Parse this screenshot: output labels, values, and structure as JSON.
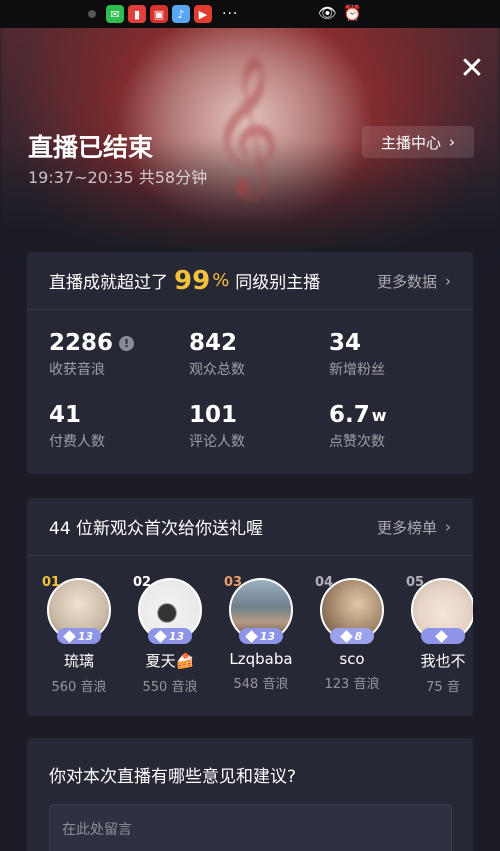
{
  "status_bar": {
    "apps": [
      {
        "icon": "wechat-icon",
        "color": "#2fbd52",
        "glyph": "✉"
      },
      {
        "icon": "book-icon",
        "color": "#e0403c",
        "glyph": "▮"
      },
      {
        "icon": "news-icon",
        "color": "#d8322e",
        "glyph": "▣"
      },
      {
        "icon": "music-icon",
        "color": "#5aa6f2",
        "glyph": "♪"
      },
      {
        "icon": "video-icon",
        "color": "#e23b2f",
        "glyph": "▶"
      }
    ],
    "more": "···",
    "right_icons": [
      "eye-icon",
      "alarm-icon"
    ]
  },
  "header": {
    "title": "直播已结束",
    "time_range": "19:37~20:35 共58分钟",
    "host_center_label": "主播中心"
  },
  "achievement": {
    "prefix": "直播成就超过了",
    "percent": "99",
    "percent_sign": "%",
    "suffix": "同级别主播",
    "more_label": "更多数据",
    "accent_color": "#f5c23e"
  },
  "stats": [
    {
      "value": "2286",
      "unit": "",
      "label": "收获音浪",
      "info": true
    },
    {
      "value": "842",
      "unit": "",
      "label": "观众总数",
      "info": false
    },
    {
      "value": "34",
      "unit": "",
      "label": "新增粉丝",
      "info": false
    },
    {
      "value": "41",
      "unit": "",
      "label": "付费人数",
      "info": false
    },
    {
      "value": "101",
      "unit": "",
      "label": "评论人数",
      "info": false
    },
    {
      "value": "6.7",
      "unit": "w",
      "label": "点赞次数",
      "info": false
    }
  ],
  "gifts": {
    "title": "44 位新观众首次给你送礼喔",
    "more_label": "更多榜单",
    "gifters": [
      {
        "rank": "01",
        "rank_color": "#f5c23e",
        "level": "13",
        "name": "琉璃",
        "score": "560 音浪",
        "avatar_color": "#c9b9a5"
      },
      {
        "rank": "02",
        "rank_color": "#ffffff",
        "level": "13",
        "name": "夏天🍰",
        "score": "550 音浪",
        "avatar_color": "#e6e6e6"
      },
      {
        "rank": "03",
        "rank_color": "#e8a06a",
        "level": "13",
        "name": "Lzqbaba",
        "score": "548 音浪",
        "avatar_color": "#7f8e9a"
      },
      {
        "rank": "04",
        "rank_color": "#b0b0b8",
        "level": "8",
        "name": "sco",
        "score": "123 音浪",
        "avatar_color": "#a78a6e"
      },
      {
        "rank": "05",
        "rank_color": "#b0b0b8",
        "level": "",
        "name": "我也不",
        "score": "75 音",
        "avatar_color": "#e7d4c6"
      }
    ]
  },
  "feedback": {
    "title": "你对本次直播有哪些意见和建议?",
    "placeholder": "在此处留言"
  }
}
